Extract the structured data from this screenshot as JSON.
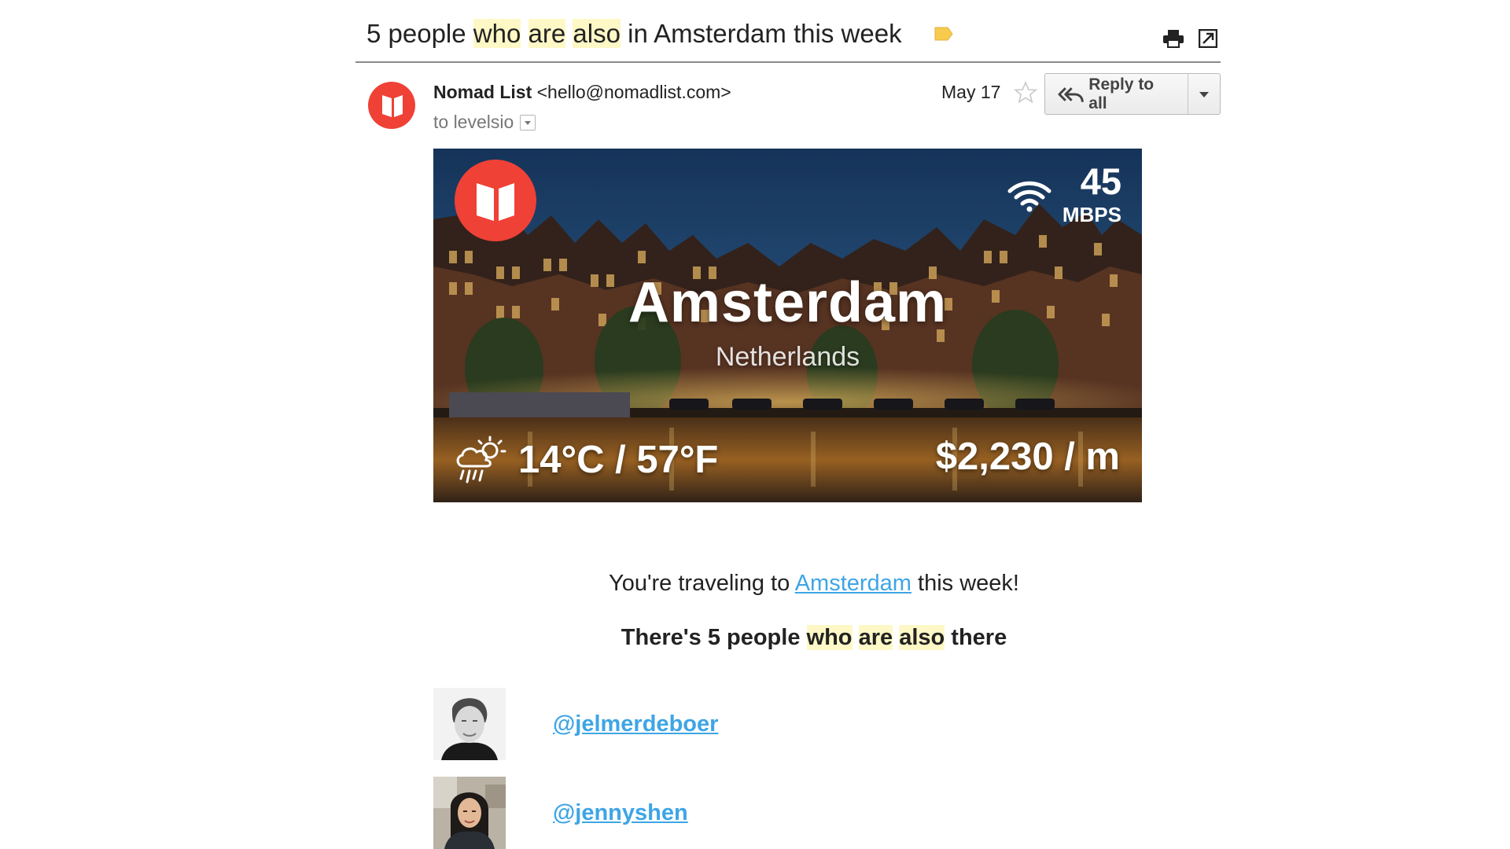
{
  "subject": {
    "prefix": "5 people ",
    "hl1": "who",
    "hl2": "are",
    "hl3": "also",
    "suffix": " in Amsterdam this week",
    "label_color": "#f7cb4d"
  },
  "toolbar": {
    "print_icon": "print-icon",
    "popout_icon": "open-in-new-window-icon"
  },
  "sender": {
    "name": "Nomad List",
    "email": "<hello@nomadlist.com>",
    "to_label": "to levelsio",
    "date": "May 17"
  },
  "reply": {
    "label": "Reply to all"
  },
  "hero": {
    "speed": "45",
    "speed_unit": "MBPS",
    "city": "Amsterdam",
    "country": "Netherlands",
    "weather": "14°C /  57°F",
    "weather_icon": "rain-sun-cloud-icon",
    "cost": "$2,230 / m",
    "brand_color": "#ef4136"
  },
  "body": {
    "travel_prefix": "You're traveling to ",
    "travel_link": "Amsterdam",
    "travel_suffix": " this week!",
    "people_prefix": "There's 5 people ",
    "people_hl1": "who",
    "people_hl2": "are",
    "people_hl3": "also",
    "people_suffix": " there",
    "link_color": "#3ea5e5"
  },
  "people": [
    {
      "handle": "@jelmerdeboer"
    },
    {
      "handle": "@jennyshen"
    }
  ]
}
